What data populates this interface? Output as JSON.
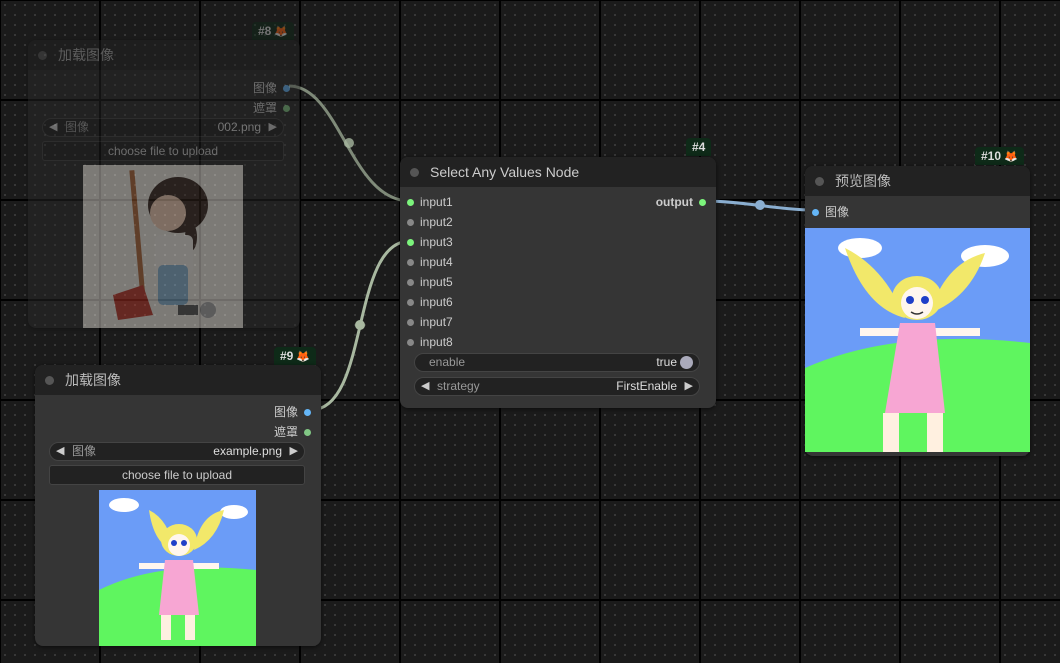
{
  "node8": {
    "id_badge": "#8",
    "title": "加载图像",
    "outputs": [
      "图像",
      "遮罩"
    ],
    "image_widget": {
      "label": "图像",
      "value": "002.png"
    },
    "upload_label": "choose file to upload"
  },
  "node9": {
    "id_badge": "#9",
    "title": "加载图像",
    "outputs": [
      "图像",
      "遮罩"
    ],
    "image_widget": {
      "label": "图像",
      "value": "example.png"
    },
    "upload_label": "choose file to upload"
  },
  "node4": {
    "id_badge": "#4",
    "title": "Select Any Values Node",
    "inputs": [
      "input1",
      "input2",
      "input3",
      "input4",
      "input5",
      "input6",
      "input7",
      "input8"
    ],
    "output": "output",
    "enable_widget": {
      "label": "enable",
      "value": "true"
    },
    "strategy_widget": {
      "label": "strategy",
      "value": "FirstEnable"
    }
  },
  "node10": {
    "id_badge": "#10",
    "title": "预览图像",
    "inputs": [
      "图像"
    ]
  },
  "colors": {
    "connected_pin": "#7cf47c",
    "image_pin": "#64b5f6",
    "mask_pin": "#81c784",
    "link_image": "#a8b8a0",
    "link_output": "#8aaed0",
    "badge_bg": "#0e2a18"
  }
}
